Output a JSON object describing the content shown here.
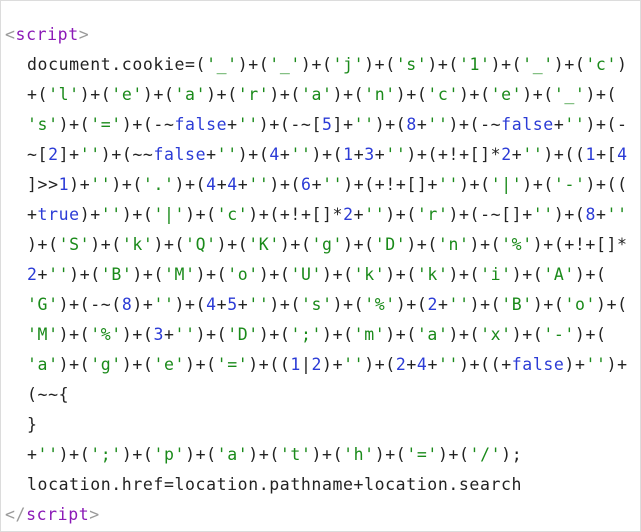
{
  "colors": {
    "tag_name": "#8b19b7",
    "tag_bracket": "#9a9a9a",
    "string": "#1a8a1a",
    "number_keyword": "#2b3bd6",
    "plain": "#222222"
  },
  "open_tag": {
    "lt": "<",
    "name": "script",
    "gt": ">"
  },
  "close_tag": {
    "lt": "</",
    "name": "script",
    "gt": ">"
  },
  "code_lines": [
    [
      [
        "p",
        "document.cookie=("
      ],
      [
        "s",
        "'_'"
      ],
      [
        "p",
        ")+("
      ],
      [
        "s",
        "'_'"
      ],
      [
        "p",
        ")+("
      ],
      [
        "s",
        "'j'"
      ],
      [
        "p",
        ")+("
      ],
      [
        "s",
        "'s'"
      ],
      [
        "p",
        ")+("
      ],
      [
        "s",
        "'1'"
      ],
      [
        "p",
        ")+("
      ],
      [
        "s",
        "'_'"
      ],
      [
        "p",
        ")+("
      ],
      [
        "s",
        "'c'"
      ],
      [
        "p",
        ")"
      ]
    ],
    [
      [
        "p",
        "+("
      ],
      [
        "s",
        "'l'"
      ],
      [
        "p",
        ")+("
      ],
      [
        "s",
        "'e'"
      ],
      [
        "p",
        ")+("
      ],
      [
        "s",
        "'a'"
      ],
      [
        "p",
        ")+("
      ],
      [
        "s",
        "'r'"
      ],
      [
        "p",
        ")+("
      ],
      [
        "s",
        "'a'"
      ],
      [
        "p",
        ")+("
      ],
      [
        "s",
        "'n'"
      ],
      [
        "p",
        ")+("
      ],
      [
        "s",
        "'c'"
      ],
      [
        "p",
        ")+("
      ],
      [
        "s",
        "'e'"
      ],
      [
        "p",
        ")+("
      ],
      [
        "s",
        "'_'"
      ],
      [
        "p",
        ")+("
      ]
    ],
    [
      [
        "s",
        "'s'"
      ],
      [
        "p",
        ")+("
      ],
      [
        "s",
        "'='"
      ],
      [
        "p",
        ")+(-~"
      ],
      [
        "k",
        "false"
      ],
      [
        "p",
        "+"
      ],
      [
        "s",
        "''"
      ],
      [
        "p",
        ")+(-~["
      ],
      [
        "n",
        "5"
      ],
      [
        "p",
        "]+"
      ],
      [
        "s",
        "''"
      ],
      [
        "p",
        ")+("
      ],
      [
        "n",
        "8"
      ],
      [
        "p",
        "+"
      ],
      [
        "s",
        "''"
      ],
      [
        "p",
        ")+(-~"
      ],
      [
        "k",
        "false"
      ],
      [
        "p",
        "+"
      ],
      [
        "s",
        "''"
      ],
      [
        "p",
        ")+(-"
      ]
    ],
    [
      [
        "p",
        "~["
      ],
      [
        "n",
        "2"
      ],
      [
        "p",
        "]+"
      ],
      [
        "s",
        "''"
      ],
      [
        "p",
        ")+(~~"
      ],
      [
        "k",
        "false"
      ],
      [
        "p",
        "+"
      ],
      [
        "s",
        "''"
      ],
      [
        "p",
        ")+("
      ],
      [
        "n",
        "4"
      ],
      [
        "p",
        "+"
      ],
      [
        "s",
        "''"
      ],
      [
        "p",
        ")+("
      ],
      [
        "n",
        "1"
      ],
      [
        "p",
        "+"
      ],
      [
        "n",
        "3"
      ],
      [
        "p",
        "+"
      ],
      [
        "s",
        "''"
      ],
      [
        "p",
        ")+(+!+[]*"
      ],
      [
        "n",
        "2"
      ],
      [
        "p",
        "+"
      ],
      [
        "s",
        "''"
      ],
      [
        "p",
        ")+(("
      ],
      [
        "n",
        "1"
      ],
      [
        "p",
        "+["
      ],
      [
        "n",
        "4"
      ]
    ],
    [
      [
        "p",
        "]>>"
      ],
      [
        "n",
        "1"
      ],
      [
        "p",
        ")+"
      ],
      [
        "s",
        "''"
      ],
      [
        "p",
        ")+("
      ],
      [
        "s",
        "'.'"
      ],
      [
        "p",
        ")+("
      ],
      [
        "n",
        "4"
      ],
      [
        "p",
        "+"
      ],
      [
        "n",
        "4"
      ],
      [
        "p",
        "+"
      ],
      [
        "s",
        "''"
      ],
      [
        "p",
        ")+("
      ],
      [
        "n",
        "6"
      ],
      [
        "p",
        "+"
      ],
      [
        "s",
        "''"
      ],
      [
        "p",
        ")+(+!+[]+"
      ],
      [
        "s",
        "''"
      ],
      [
        "p",
        ")+("
      ],
      [
        "s",
        "'|'"
      ],
      [
        "p",
        ")+("
      ],
      [
        "s",
        "'-'"
      ],
      [
        "p",
        ")+(("
      ]
    ],
    [
      [
        "p",
        "+"
      ],
      [
        "k",
        "true"
      ],
      [
        "p",
        ")+"
      ],
      [
        "s",
        "''"
      ],
      [
        "p",
        ")+("
      ],
      [
        "s",
        "'|'"
      ],
      [
        "p",
        ")+("
      ],
      [
        "s",
        "'c'"
      ],
      [
        "p",
        ")+(+!+[]*"
      ],
      [
        "n",
        "2"
      ],
      [
        "p",
        "+"
      ],
      [
        "s",
        "''"
      ],
      [
        "p",
        ")+("
      ],
      [
        "s",
        "'r'"
      ],
      [
        "p",
        ")+(-~[]+"
      ],
      [
        "s",
        "''"
      ],
      [
        "p",
        ")+("
      ],
      [
        "n",
        "8"
      ],
      [
        "p",
        "+"
      ],
      [
        "s",
        "''"
      ]
    ],
    [
      [
        "p",
        ")+("
      ],
      [
        "s",
        "'S'"
      ],
      [
        "p",
        ")+("
      ],
      [
        "s",
        "'k'"
      ],
      [
        "p",
        ")+("
      ],
      [
        "s",
        "'Q'"
      ],
      [
        "p",
        ")+("
      ],
      [
        "s",
        "'K'"
      ],
      [
        "p",
        ")+("
      ],
      [
        "s",
        "'g'"
      ],
      [
        "p",
        ")+("
      ],
      [
        "s",
        "'D'"
      ],
      [
        "p",
        ")+("
      ],
      [
        "s",
        "'n'"
      ],
      [
        "p",
        ")+("
      ],
      [
        "s",
        "'%'"
      ],
      [
        "p",
        ")+(+!+[]*"
      ]
    ],
    [
      [
        "n",
        "2"
      ],
      [
        "p",
        "+"
      ],
      [
        "s",
        "''"
      ],
      [
        "p",
        ")+("
      ],
      [
        "s",
        "'B'"
      ],
      [
        "p",
        ")+("
      ],
      [
        "s",
        "'M'"
      ],
      [
        "p",
        ")+("
      ],
      [
        "s",
        "'o'"
      ],
      [
        "p",
        ")+("
      ],
      [
        "s",
        "'U'"
      ],
      [
        "p",
        ")+("
      ],
      [
        "s",
        "'k'"
      ],
      [
        "p",
        ")+("
      ],
      [
        "s",
        "'k'"
      ],
      [
        "p",
        ")+("
      ],
      [
        "s",
        "'i'"
      ],
      [
        "p",
        ")+("
      ],
      [
        "s",
        "'A'"
      ],
      [
        "p",
        ")+("
      ]
    ],
    [
      [
        "s",
        "'G'"
      ],
      [
        "p",
        ")+(-~("
      ],
      [
        "n",
        "8"
      ],
      [
        "p",
        ")+"
      ],
      [
        "s",
        "''"
      ],
      [
        "p",
        ")+("
      ],
      [
        "n",
        "4"
      ],
      [
        "p",
        "+"
      ],
      [
        "n",
        "5"
      ],
      [
        "p",
        "+"
      ],
      [
        "s",
        "''"
      ],
      [
        "p",
        ")+("
      ],
      [
        "s",
        "'s'"
      ],
      [
        "p",
        ")+("
      ],
      [
        "s",
        "'%'"
      ],
      [
        "p",
        ")+("
      ],
      [
        "n",
        "2"
      ],
      [
        "p",
        "+"
      ],
      [
        "s",
        "''"
      ],
      [
        "p",
        ")+("
      ],
      [
        "s",
        "'B'"
      ],
      [
        "p",
        ")+("
      ],
      [
        "s",
        "'o'"
      ],
      [
        "p",
        ")+("
      ]
    ],
    [
      [
        "s",
        "'M'"
      ],
      [
        "p",
        ")+("
      ],
      [
        "s",
        "'%'"
      ],
      [
        "p",
        ")+("
      ],
      [
        "n",
        "3"
      ],
      [
        "p",
        "+"
      ],
      [
        "s",
        "''"
      ],
      [
        "p",
        ")+("
      ],
      [
        "s",
        "'D'"
      ],
      [
        "p",
        ")+("
      ],
      [
        "s",
        "';'"
      ],
      [
        "p",
        ")+("
      ],
      [
        "s",
        "'m'"
      ],
      [
        "p",
        ")+("
      ],
      [
        "s",
        "'a'"
      ],
      [
        "p",
        ")+("
      ],
      [
        "s",
        "'x'"
      ],
      [
        "p",
        ")+("
      ],
      [
        "s",
        "'-'"
      ],
      [
        "p",
        ")+("
      ]
    ],
    [
      [
        "s",
        "'a'"
      ],
      [
        "p",
        ")+("
      ],
      [
        "s",
        "'g'"
      ],
      [
        "p",
        ")+("
      ],
      [
        "s",
        "'e'"
      ],
      [
        "p",
        ")+("
      ],
      [
        "s",
        "'='"
      ],
      [
        "p",
        ")+(("
      ],
      [
        "n",
        "1"
      ],
      [
        "p",
        "|"
      ],
      [
        "n",
        "2"
      ],
      [
        "p",
        ")+"
      ],
      [
        "s",
        "''"
      ],
      [
        "p",
        ")+("
      ],
      [
        "n",
        "2"
      ],
      [
        "p",
        "+"
      ],
      [
        "n",
        "4"
      ],
      [
        "p",
        "+"
      ],
      [
        "s",
        "''"
      ],
      [
        "p",
        ")+((+"
      ],
      [
        "k",
        "false"
      ],
      [
        "p",
        ")+"
      ],
      [
        "s",
        "''"
      ],
      [
        "p",
        ")+"
      ]
    ],
    [
      [
        "p",
        "(~~{"
      ]
    ],
    [
      [
        "p",
        "}"
      ]
    ],
    [
      [
        "p",
        "+"
      ],
      [
        "s",
        "''"
      ],
      [
        "p",
        ")+("
      ],
      [
        "s",
        "';'"
      ],
      [
        "p",
        ")+("
      ],
      [
        "s",
        "'p'"
      ],
      [
        "p",
        ")+("
      ],
      [
        "s",
        "'a'"
      ],
      [
        "p",
        ")+("
      ],
      [
        "s",
        "'t'"
      ],
      [
        "p",
        ")+("
      ],
      [
        "s",
        "'h'"
      ],
      [
        "p",
        ")+("
      ],
      [
        "s",
        "'='"
      ],
      [
        "p",
        ")+("
      ],
      [
        "s",
        "'/'"
      ],
      [
        "p",
        ");"
      ]
    ],
    [
      [
        "p",
        "location.href=location.pathname+location.search"
      ]
    ]
  ]
}
